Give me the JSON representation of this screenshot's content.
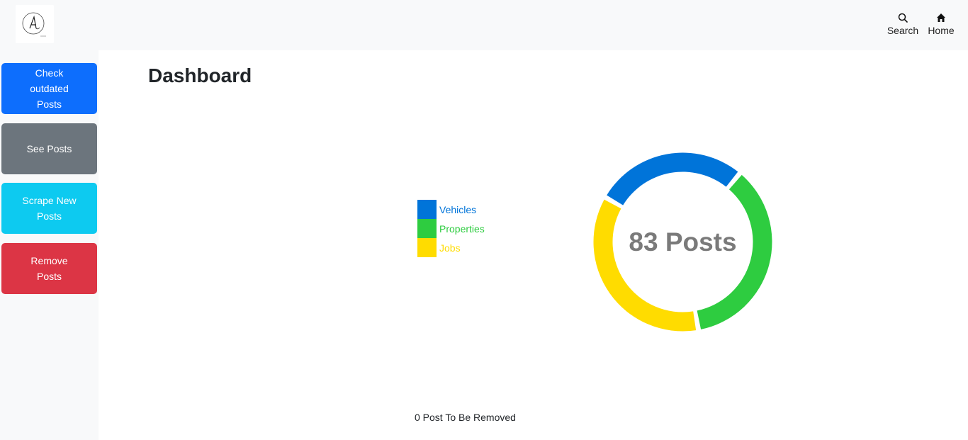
{
  "header": {
    "nav": [
      {
        "label": "Search",
        "icon": "search-icon"
      },
      {
        "label": "Home",
        "icon": "home-icon"
      }
    ]
  },
  "sidebar": {
    "buttons": [
      {
        "label": "Check outdated Posts",
        "color": "#0d6efd"
      },
      {
        "label": "See Posts",
        "color": "#6c757d"
      },
      {
        "label": "Scrape New Posts",
        "color": "#0dcaf0"
      },
      {
        "label": "Remove Posts",
        "color": "#dc3545"
      }
    ]
  },
  "main": {
    "title": "Dashboard",
    "total_label": "83 Posts",
    "footer_note": "0 Post To Be Removed"
  },
  "chart_data": {
    "type": "pie",
    "title": "",
    "categories": [
      "Vehicles",
      "Properties",
      "Jobs"
    ],
    "values": [
      23,
      30,
      30
    ],
    "colors": [
      "#0074d9",
      "#2ecc40",
      "#ffdc00"
    ],
    "legend": "left",
    "center_label": "83 Posts"
  }
}
